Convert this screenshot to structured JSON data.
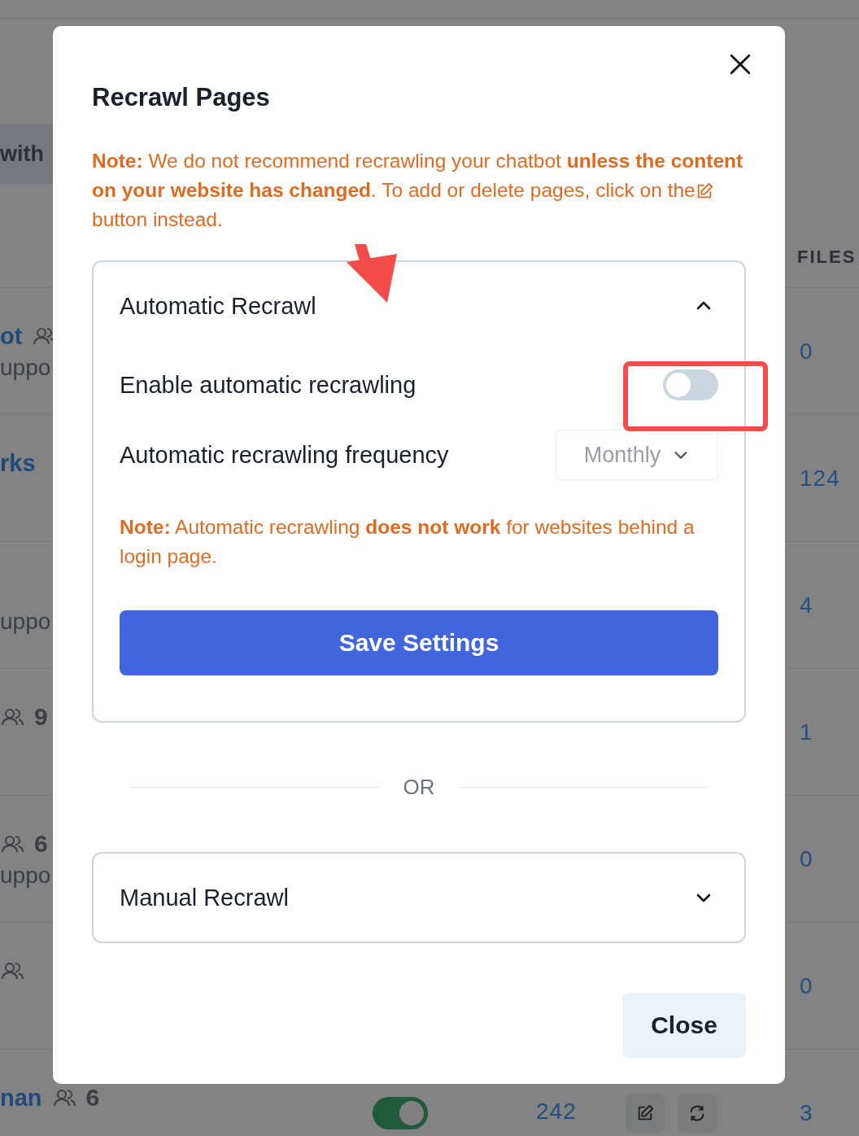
{
  "background": {
    "badge": "with",
    "files_header": "FILES",
    "rows": [
      {
        "title": "ot",
        "member_icon": true,
        "subtitle": "uppo",
        "files": "0"
      },
      {
        "title": "rks",
        "member_icon": false,
        "files": "124"
      },
      {
        "title": "",
        "member_icon": false,
        "subtitle": "uppo",
        "files": "4"
      },
      {
        "member_icon": true,
        "members": "9",
        "files": "1"
      },
      {
        "member_icon": true,
        "members": "6",
        "subtitle": "uppo",
        "files": "0"
      },
      {
        "member_icon": true,
        "files": "0"
      },
      {
        "title": "nan",
        "member_icon": true,
        "members": "6",
        "enabled": true,
        "pages": "242",
        "files": "3"
      }
    ]
  },
  "dialog": {
    "title": "Recrawl Pages",
    "note": {
      "before_icon": "**Note:** We do not recommend recrawling your chatbot **unless the content on your website has changed**. To add or delete pages, click on the",
      "after_icon": "button instead."
    },
    "automatic": {
      "title": "Automatic Recrawl",
      "expanded": true,
      "enable_label": "Enable automatic recrawling",
      "enabled": false,
      "frequency_label": "Automatic recrawling frequency",
      "frequency": "Monthly",
      "frequency_disabled": true,
      "note": "**Note:** Automatic recrawling **does not work** for websites behind a login page.",
      "save": "Save Settings"
    },
    "separator": "OR",
    "manual": {
      "title": "Manual Recrawl",
      "expanded": false
    },
    "close": "Close"
  }
}
